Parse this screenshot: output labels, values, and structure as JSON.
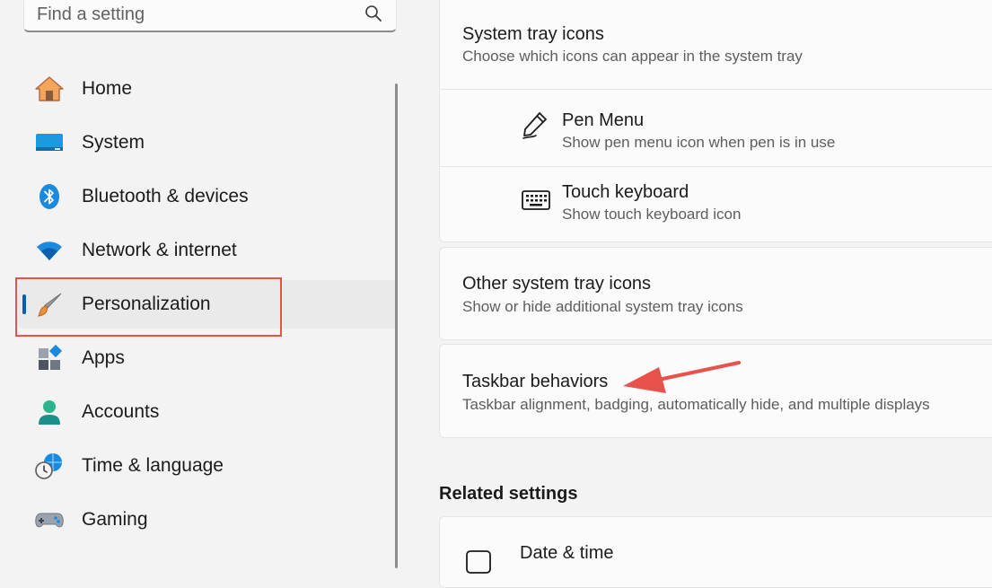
{
  "search": {
    "placeholder": "Find a setting"
  },
  "nav": {
    "items": [
      {
        "label": "Home",
        "icon": "home-icon"
      },
      {
        "label": "System",
        "icon": "monitor-icon"
      },
      {
        "label": "Bluetooth & devices",
        "icon": "bluetooth-icon"
      },
      {
        "label": "Network & internet",
        "icon": "wifi-icon"
      },
      {
        "label": "Personalization",
        "icon": "paintbrush-icon",
        "active": true
      },
      {
        "label": "Apps",
        "icon": "apps-icon"
      },
      {
        "label": "Accounts",
        "icon": "person-icon"
      },
      {
        "label": "Time & language",
        "icon": "clock-globe-icon"
      },
      {
        "label": "Gaming",
        "icon": "gamepad-icon"
      }
    ]
  },
  "content": {
    "system_tray": {
      "title": "System tray icons",
      "description": "Choose which icons can appear in the system tray",
      "items": [
        {
          "title": "Pen Menu",
          "description": "Show pen menu icon when pen is in use",
          "icon": "pen-icon"
        },
        {
          "title": "Touch keyboard",
          "description": "Show touch keyboard icon",
          "icon": "keyboard-icon"
        }
      ]
    },
    "other_tray": {
      "title": "Other system tray icons",
      "description": "Show or hide additional system tray icons"
    },
    "taskbar_behaviors": {
      "title": "Taskbar behaviors",
      "description": "Taskbar alignment, badging, automatically hide, and multiple displays"
    },
    "related_settings": {
      "heading": "Related settings",
      "items": [
        {
          "title": "Date & time",
          "icon": "calendar-clock-icon"
        }
      ]
    }
  },
  "annotations": {
    "highlight_color": "#e9524a",
    "arrow_color": "#e9524a"
  },
  "colors": {
    "accent": "#005fb8",
    "background": "#f3f3f3",
    "card": "#fbfbfb"
  }
}
